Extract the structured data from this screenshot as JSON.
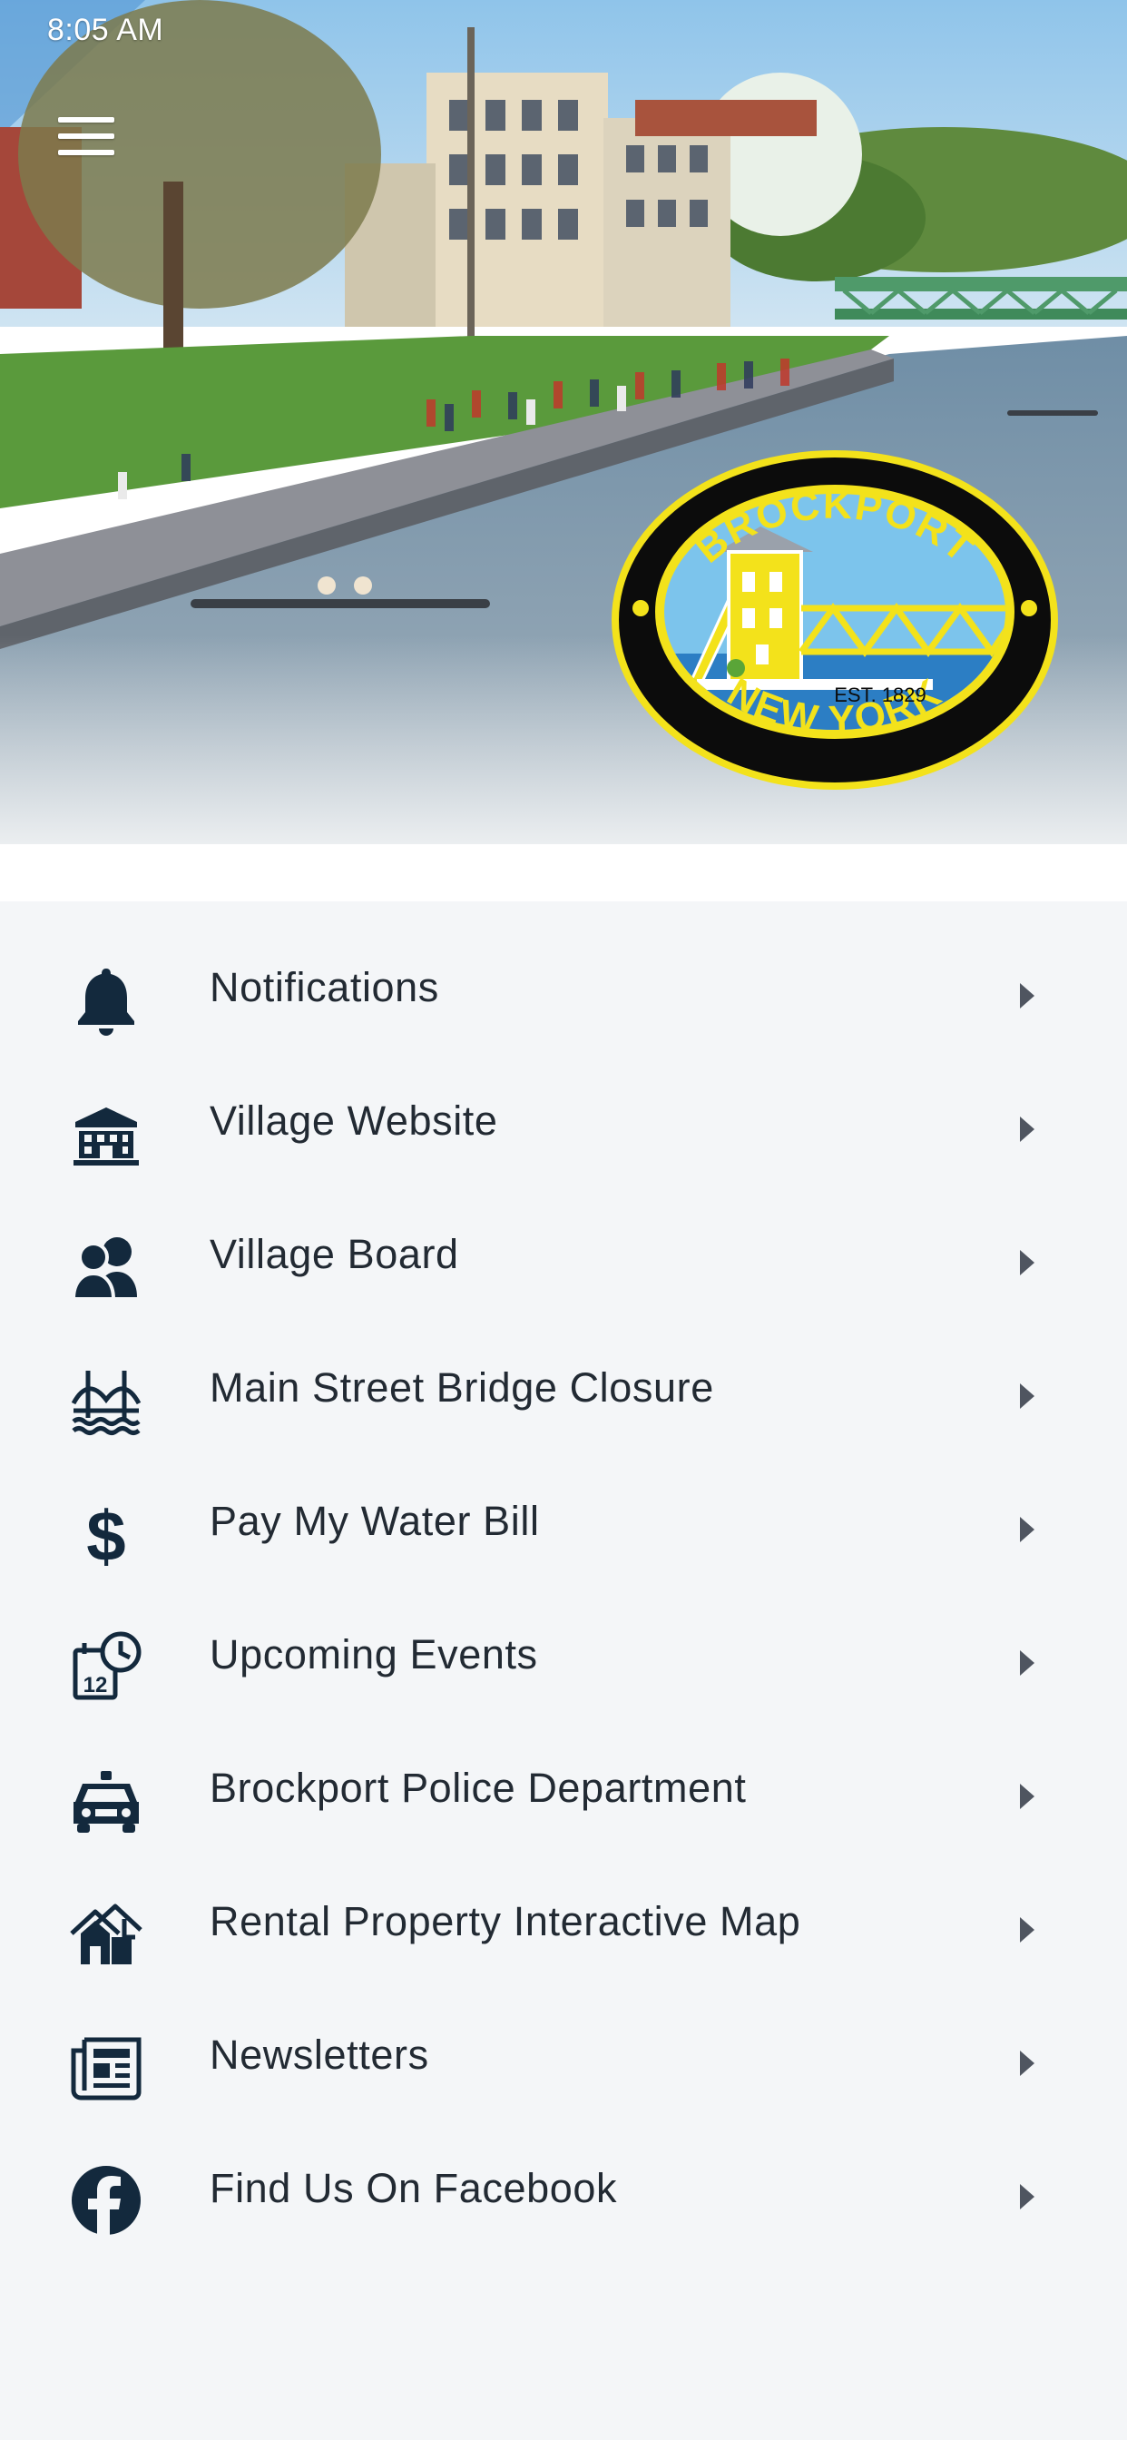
{
  "status_bar": {
    "time": "8:05 AM"
  },
  "header": {
    "menu_icon": "hamburger-menu-icon",
    "seal": {
      "top_text": "BROCKPORT",
      "bottom_text": "NEW YORK",
      "established": "EST. 1829"
    }
  },
  "colors": {
    "icon": "#13293d",
    "text": "#222a33",
    "list_background": "#f4f6f8",
    "seal_yellow": "#f3e21b",
    "seal_sky": "#7cc4ec",
    "seal_water": "#2c7ec4"
  },
  "menu": {
    "items": [
      {
        "label": "Notifications",
        "icon": "bell-icon"
      },
      {
        "label": "Village Website",
        "icon": "building-icon"
      },
      {
        "label": "Village Board",
        "icon": "users-icon"
      },
      {
        "label": "Main Street Bridge Closure",
        "icon": "bridge-icon"
      },
      {
        "label": "Pay My Water Bill",
        "icon": "dollar-icon"
      },
      {
        "label": "Upcoming Events",
        "icon": "calendar-clock-icon"
      },
      {
        "label": "Brockport Police Department",
        "icon": "police-car-icon"
      },
      {
        "label": "Rental Property Interactive Map",
        "icon": "houses-icon"
      },
      {
        "label": "Newsletters",
        "icon": "newspaper-icon"
      },
      {
        "label": "Find Us On Facebook",
        "icon": "facebook-icon"
      }
    ]
  }
}
